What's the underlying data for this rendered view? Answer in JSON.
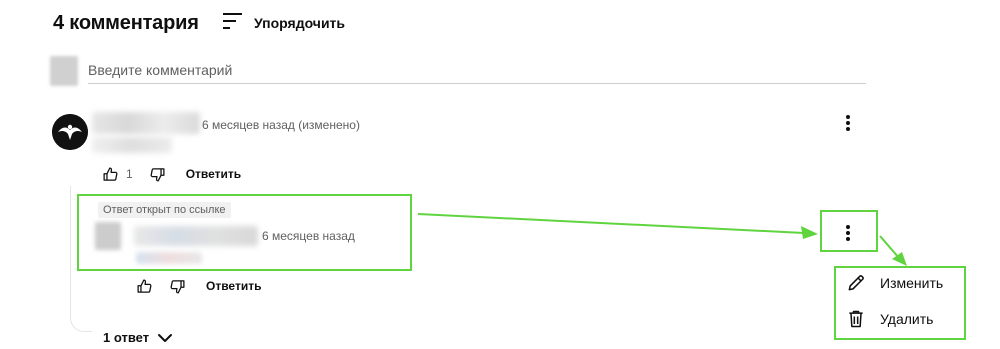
{
  "header": {
    "title": "4 комментария",
    "sort_label": "Упорядочить"
  },
  "composer": {
    "placeholder": "Введите комментарий"
  },
  "comment": {
    "time": "6 месяцев назад (изменено)",
    "likes": "1",
    "reply_label": "Ответить"
  },
  "reply": {
    "badge": "Ответ открыт по ссылке",
    "time": "6 месяцев назад",
    "reply_label": "Ответить"
  },
  "menu": {
    "edit_label": "Изменить",
    "delete_label": "Удалить"
  },
  "replies_toggle": {
    "label": "1 ответ"
  },
  "colors": {
    "highlight": "#5fd43f",
    "text": "#0f0f0f",
    "muted": "#606060"
  }
}
